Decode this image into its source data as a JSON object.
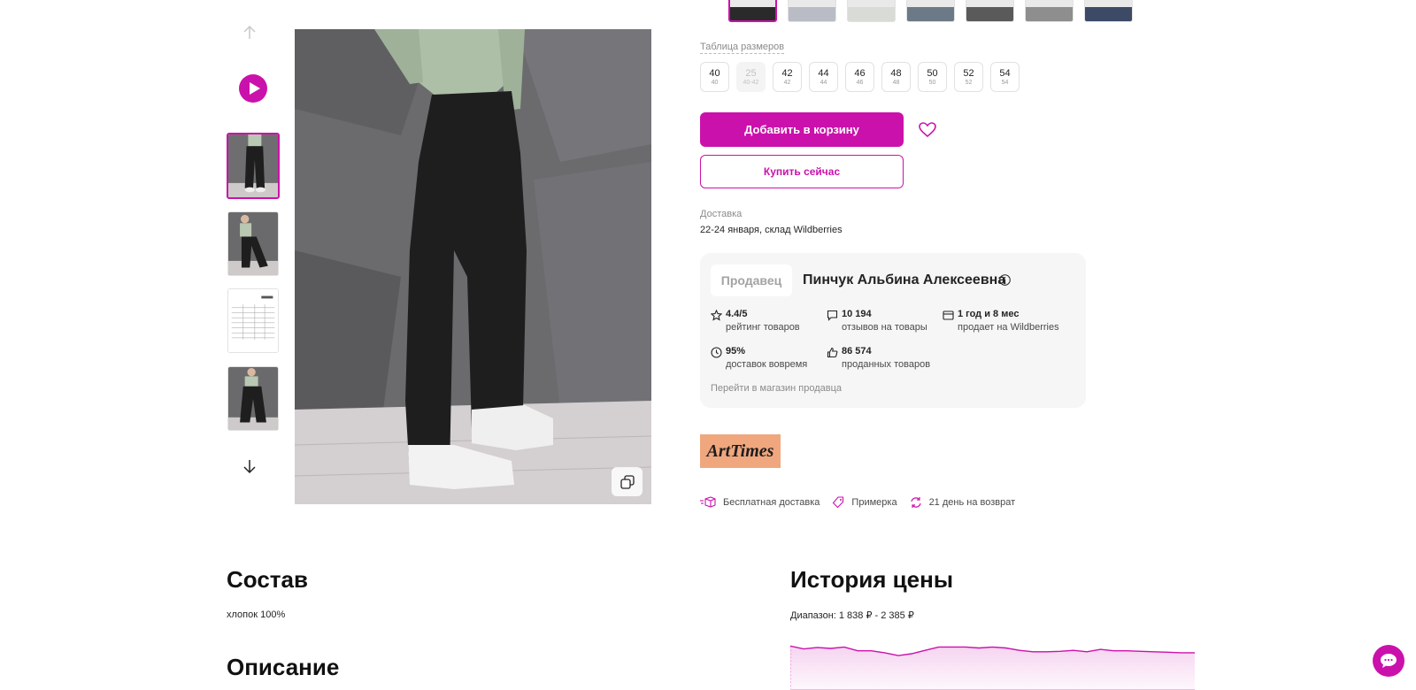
{
  "gallery": {
    "thumbnails": [
      "photo-1",
      "photo-2",
      "size-chart",
      "photo-4"
    ],
    "active_index": 0
  },
  "colors": {
    "count": 7,
    "active_index": 0
  },
  "sizes": {
    "table_link": "Таблица размеров",
    "items": [
      {
        "size": "40",
        "ru": "40",
        "available": true
      },
      {
        "size": "25",
        "ru": "40-42",
        "available": false
      },
      {
        "size": "42",
        "ru": "42",
        "available": true
      },
      {
        "size": "44",
        "ru": "44",
        "available": true
      },
      {
        "size": "46",
        "ru": "46",
        "available": true
      },
      {
        "size": "48",
        "ru": "48",
        "available": true
      },
      {
        "size": "50",
        "ru": "50",
        "available": true
      },
      {
        "size": "52",
        "ru": "52",
        "available": true
      },
      {
        "size": "54",
        "ru": "54",
        "available": true
      }
    ]
  },
  "actions": {
    "add_to_cart": "Добавить в корзину",
    "buy_now": "Купить сейчас"
  },
  "delivery": {
    "label": "Доставка",
    "value": "22-24 января, склад Wildberries"
  },
  "seller": {
    "tag": "Продавец",
    "name": "Пинчук Альбина Алексеевна",
    "stats": [
      {
        "icon": "star-icon",
        "value": "4.4/5",
        "label": "рейтинг товаров"
      },
      {
        "icon": "comment-icon",
        "value": "10 194",
        "label": "отзывов на товары"
      },
      {
        "icon": "store-icon",
        "value": "1 год и 8 мес",
        "label": "продает на Wildberries"
      },
      {
        "icon": "clock-icon",
        "value": "95%",
        "label": "доставок вовремя"
      },
      {
        "icon": "thumbs-up-icon",
        "value": "86 574",
        "label": "проданных товаров"
      }
    ],
    "store_link": "Перейти в магазин продавца"
  },
  "brand": {
    "logo_text": "ArtTimes"
  },
  "features": [
    {
      "icon": "delivery-box-icon",
      "label": "Бесплатная доставка"
    },
    {
      "icon": "tag-icon",
      "label": "Примерка"
    },
    {
      "icon": "return-icon",
      "label": "21 день на возврат"
    }
  ],
  "composition": {
    "title": "Состав",
    "value": "хлопок 100%"
  },
  "description": {
    "title": "Описание"
  },
  "price_history": {
    "title": "История цены",
    "range": "Диапазон: 1 838 ₽ - 2 385 ₽"
  },
  "chart_data": {
    "type": "area",
    "color": "#cb11ab",
    "values": [
      0.92,
      0.86,
      0.89,
      0.87,
      0.9,
      0.82,
      0.82,
      0.78,
      0.72,
      0.76,
      0.83,
      0.9,
      0.9,
      0.9,
      0.88,
      0.9,
      0.88,
      0.83,
      0.8,
      0.8,
      0.81,
      0.83,
      0.8,
      0.85,
      0.82,
      0.82,
      0.81,
      0.8,
      0.79,
      0.78,
      0.78
    ]
  },
  "theme": {
    "accent": "#cb11ab"
  }
}
